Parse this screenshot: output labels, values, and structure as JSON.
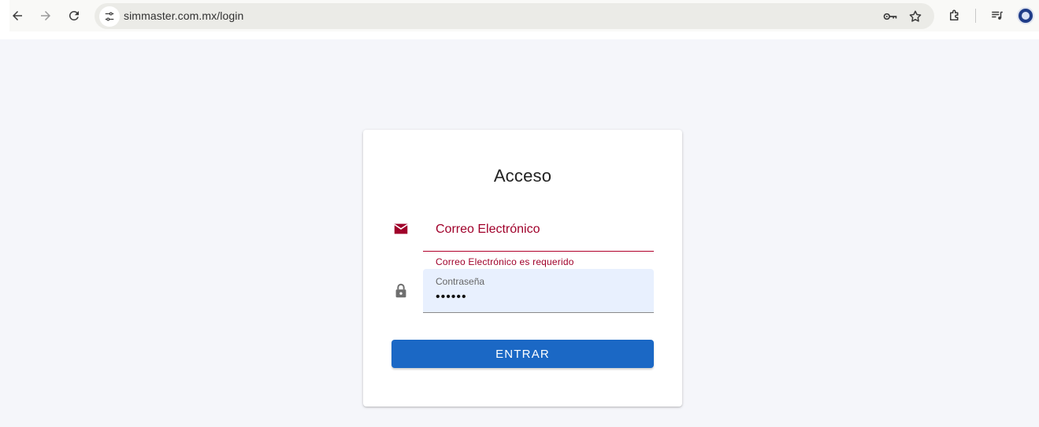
{
  "browser": {
    "url": "simmaster.com.mx/login",
    "icons": {
      "back": "arrow-left-icon",
      "forward": "arrow-right-icon",
      "reload": "reload-icon",
      "site_info": "tune-icon",
      "passwords": "key-icon",
      "bookmark": "star-icon",
      "extensions": "puzzle-icon",
      "media": "media-controls-icon",
      "profile": "profile-avatar"
    }
  },
  "login": {
    "title": "Acceso",
    "email": {
      "placeholder": "Correo Electrónico",
      "error": "Correo Electrónico es requerido",
      "icon": "mail-icon"
    },
    "password": {
      "label": "Contraseña",
      "value": "••••••",
      "icon": "lock-icon"
    },
    "submit_label": "ENTRAR"
  },
  "colors": {
    "page_bg": "#f5f6fa",
    "error": "#a0002a",
    "primary": "#1b68c5",
    "autofill_bg": "#e8f0fe"
  }
}
